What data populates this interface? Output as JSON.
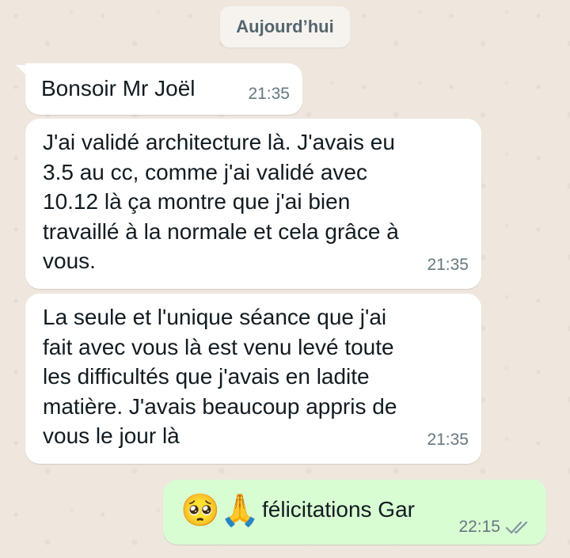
{
  "date_chip": "Aujourd’hui",
  "messages": [
    {
      "direction": "incoming",
      "text": "Bonsoir Mr Joël",
      "time": "21:35"
    },
    {
      "direction": "incoming",
      "text": "J'ai validé architecture là. J'avais eu\n3.5 au cc, comme j'ai validé avec\n10.12 là ça montre que j'ai bien\ntravaillé à la normale et cela grâce à\nvous.",
      "time": "21:35"
    },
    {
      "direction": "incoming",
      "text": "La seule et l'unique séance que j'ai\nfait avec vous là est venu levé toute\nles difficultés que j'avais en ladite\nmatière. J'avais beaucoup appris de\nvous le jour là",
      "time": "21:35"
    }
  ],
  "outgoing": {
    "emoji_1": "🥺",
    "emoji_2": "🙏",
    "text": "félicitations Gar",
    "time": "22:15",
    "status_icon": "double-check-icon"
  },
  "colors": {
    "wallpaper": "#efe7de",
    "incoming_bubble": "#ffffff",
    "outgoing_bubble": "#d9fdd3",
    "timestamp": "#667781",
    "ticks": "#8696a0"
  }
}
